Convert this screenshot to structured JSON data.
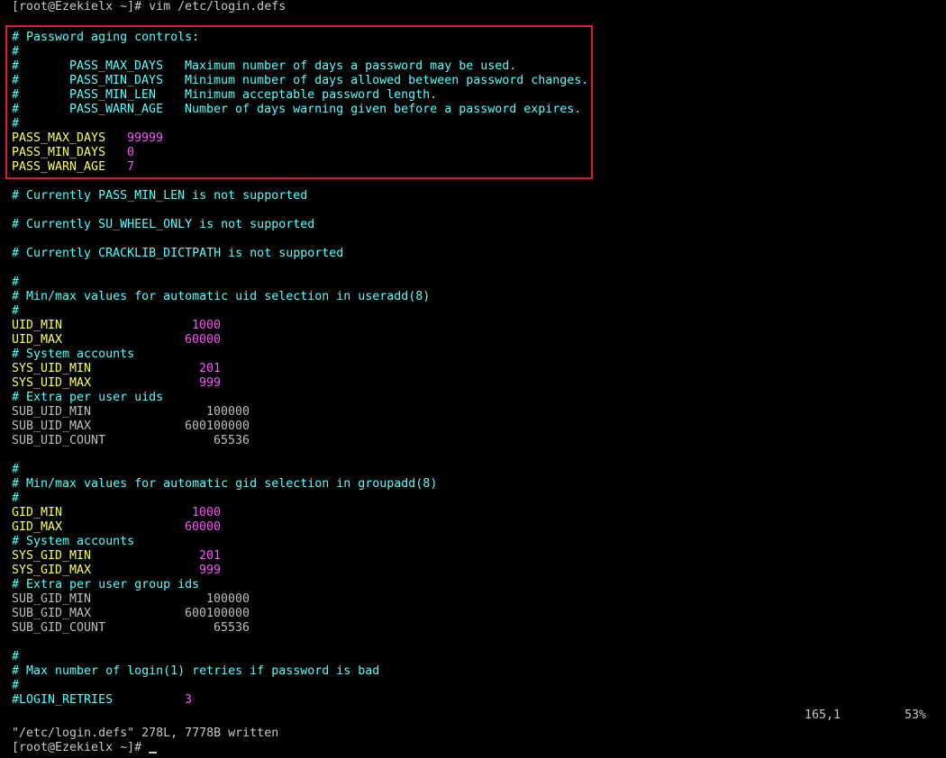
{
  "prompt_top": "[root@Ezekielx ~]# vim /etc/login.defs",
  "password_aging": {
    "header": "# Password aging controls:",
    "hash": "#",
    "params": [
      {
        "name": "PASS_MAX_DAYS",
        "desc": "Maximum number of days a password may be used."
      },
      {
        "name": "PASS_MIN_DAYS",
        "desc": "Minimum number of days allowed between password changes."
      },
      {
        "name": "PASS_MIN_LEN",
        "desc": "Minimum acceptable password length."
      },
      {
        "name": "PASS_WARN_AGE",
        "desc": "Number of days warning given before a password expires."
      }
    ],
    "settings": [
      {
        "key": "PASS_MAX_DAYS",
        "value": "99999"
      },
      {
        "key": "PASS_MIN_DAYS",
        "value": "0"
      },
      {
        "key": "PASS_WARN_AGE",
        "value": "7"
      }
    ]
  },
  "notes": [
    "# Currently PASS_MIN_LEN is not supported",
    "# Currently SU_WHEEL_ONLY is not supported",
    "# Currently CRACKLIB_DICTPATH is not supported"
  ],
  "uid_section": {
    "hash": "#",
    "header": "# Min/max values for automatic uid selection in useradd(8)",
    "uid_min": {
      "key": "UID_MIN",
      "value": "1000"
    },
    "uid_max": {
      "key": "UID_MAX",
      "value": "60000"
    },
    "sys_comment": "# System accounts",
    "sys_uid_min": {
      "key": "SYS_UID_MIN",
      "value": "201"
    },
    "sys_uid_max": {
      "key": "SYS_UID_MAX",
      "value": "999"
    },
    "extra_comment": "# Extra per user uids",
    "sub_uid_min": {
      "key": "SUB_UID_MIN",
      "value": "100000"
    },
    "sub_uid_max": {
      "key": "SUB_UID_MAX",
      "value": "600100000"
    },
    "sub_uid_count": {
      "key": "SUB_UID_COUNT",
      "value": "65536"
    }
  },
  "gid_section": {
    "hash": "#",
    "header": "# Min/max values for automatic gid selection in groupadd(8)",
    "gid_min": {
      "key": "GID_MIN",
      "value": "1000"
    },
    "gid_max": {
      "key": "GID_MAX",
      "value": "60000"
    },
    "sys_comment": "# System accounts",
    "sys_gid_min": {
      "key": "SYS_GID_MIN",
      "value": "201"
    },
    "sys_gid_max": {
      "key": "SYS_GID_MAX",
      "value": "999"
    },
    "extra_comment": "# Extra per user group ids",
    "sub_gid_min": {
      "key": "SUB_GID_MIN",
      "value": "100000"
    },
    "sub_gid_max": {
      "key": "SUB_GID_MAX",
      "value": "600100000"
    },
    "sub_gid_count": {
      "key": "SUB_GID_COUNT",
      "value": "65536"
    }
  },
  "login_section": {
    "hash": "#",
    "header": "# Max number of login(1) retries if password is bad",
    "key": "#LOGIN_RETRIES",
    "value": "3"
  },
  "vim_status": {
    "position": "165,1",
    "percent": "53%"
  },
  "written_message": "\"/etc/login.defs\" 278L, 7778B written",
  "prompt_bottom": "[root@Ezekielx ~]#",
  "colors": {
    "comment": "#55ffff",
    "keyword": "#ffff55",
    "number": "#ff55ff",
    "plain": "#bfbfbf",
    "highlight_border": "#e21b2a"
  }
}
